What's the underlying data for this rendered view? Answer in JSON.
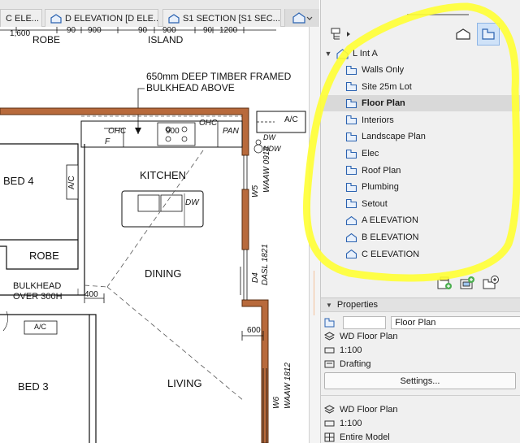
{
  "tabs": [
    {
      "label": "C ELE..."
    },
    {
      "label": "D ELEVATION [D ELE..."
    },
    {
      "label": "S1 SECTION [S1 SEC..."
    }
  ],
  "plan": {
    "dims_top": [
      "1,600",
      "90",
      "900",
      "90",
      "900",
      "90",
      "1200"
    ],
    "rooms_top": [
      "ROBE",
      "ISLAND"
    ],
    "bulkhead_note_1": "650mm DEEP TIMBER FRAMED",
    "bulkhead_note_2": "BULKHEAD ABOVE",
    "ohc_1": "OHC",
    "f": "F",
    "w900": "900",
    "ohc_2": "OHC",
    "pan": "PAN",
    "ac_1": "A/C",
    "dw_1": "DW",
    "ndw": "NDW",
    "ac_2": "A/C",
    "bed4": "BED 4",
    "kitchen": "KITCHEN",
    "dw_2": "DW",
    "robe": "ROBE",
    "dining": "DINING",
    "bulkhead_1": "BULKHEAD",
    "bulkhead_2": "OVER 300H",
    "dim_400": "400",
    "dim_600": "600",
    "ac_3": "A/C",
    "bed3": "BED 3",
    "living": "LIVING",
    "w5": "W5",
    "w5_spec": "WAAW 0918",
    "d4": "D4",
    "d4_spec": "DASL 1821",
    "w6": "W6",
    "w6_spec": "WAAW 1812"
  },
  "navigator": {
    "root": "L Int A",
    "items": [
      {
        "label": "Walls Only",
        "icon": "plan-view-icon",
        "selected": false
      },
      {
        "label": "Site 25m Lot",
        "icon": "plan-view-icon",
        "selected": false
      },
      {
        "label": "Floor Plan",
        "icon": "plan-view-icon",
        "selected": true
      },
      {
        "label": "Interiors",
        "icon": "plan-view-icon",
        "selected": false
      },
      {
        "label": "Landscape Plan",
        "icon": "plan-view-icon",
        "selected": false
      },
      {
        "label": "Elec",
        "icon": "plan-view-icon",
        "selected": false
      },
      {
        "label": "Roof Plan",
        "icon": "plan-view-icon",
        "selected": false
      },
      {
        "label": "Plumbing",
        "icon": "plan-view-icon",
        "selected": false
      },
      {
        "label": "Setout",
        "icon": "plan-view-icon",
        "selected": false
      },
      {
        "label": "A ELEVATION",
        "icon": "elevation-view-icon",
        "selected": false
      },
      {
        "label": "B ELEVATION",
        "icon": "elevation-view-icon",
        "selected": false
      },
      {
        "label": "C ELEVATION",
        "icon": "elevation-view-icon",
        "selected": false
      }
    ]
  },
  "properties": {
    "header": "Properties",
    "name_value": "Floor Plan",
    "view_1": "WD Floor Plan",
    "scale_1": "1:100",
    "layer": "Drafting",
    "settings": "Settings...",
    "view_2": "WD Floor Plan",
    "scale_2": "1:100",
    "model": "Entire Model"
  },
  "colors": {
    "wall_fill": "#b86a3c",
    "wall_stroke": "#5a2d10",
    "selection": "#cfe2f8",
    "highlight_marker": "#ffff33"
  }
}
